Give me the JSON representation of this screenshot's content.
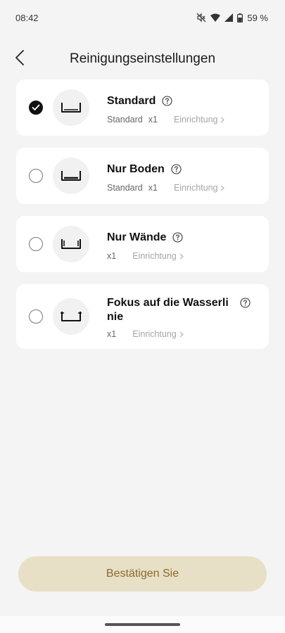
{
  "status_bar": {
    "time": "08:42",
    "battery": "59 %",
    "icons": [
      "mute-icon",
      "wifi-icon",
      "signal-icon",
      "battery-icon"
    ]
  },
  "header": {
    "title": "Reinigungseinstellungen",
    "back_icon": "chevron-left-icon"
  },
  "modes": [
    {
      "title": "Standard",
      "suction": "Standard",
      "count": "x1",
      "setup": "Einrichtung",
      "selected": true
    },
    {
      "title": "Nur Boden",
      "suction": "Standard",
      "count": "x1",
      "setup": "Einrichtung",
      "selected": false
    },
    {
      "title": "Nur Wände",
      "suction": "",
      "count": "x1",
      "setup": "Einrichtung",
      "selected": false
    },
    {
      "title": "Fokus auf die Wasserlinie",
      "suction": "",
      "count": "x1",
      "setup": "Einrichtung",
      "selected": false
    }
  ],
  "confirm_label": "Bestätigen Sie",
  "colors": {
    "background": "#f4f4f4",
    "card": "#ffffff",
    "confirm_bg": "#e8dfc7",
    "confirm_text": "#8a6a2a",
    "selected_radio": "#111111"
  }
}
